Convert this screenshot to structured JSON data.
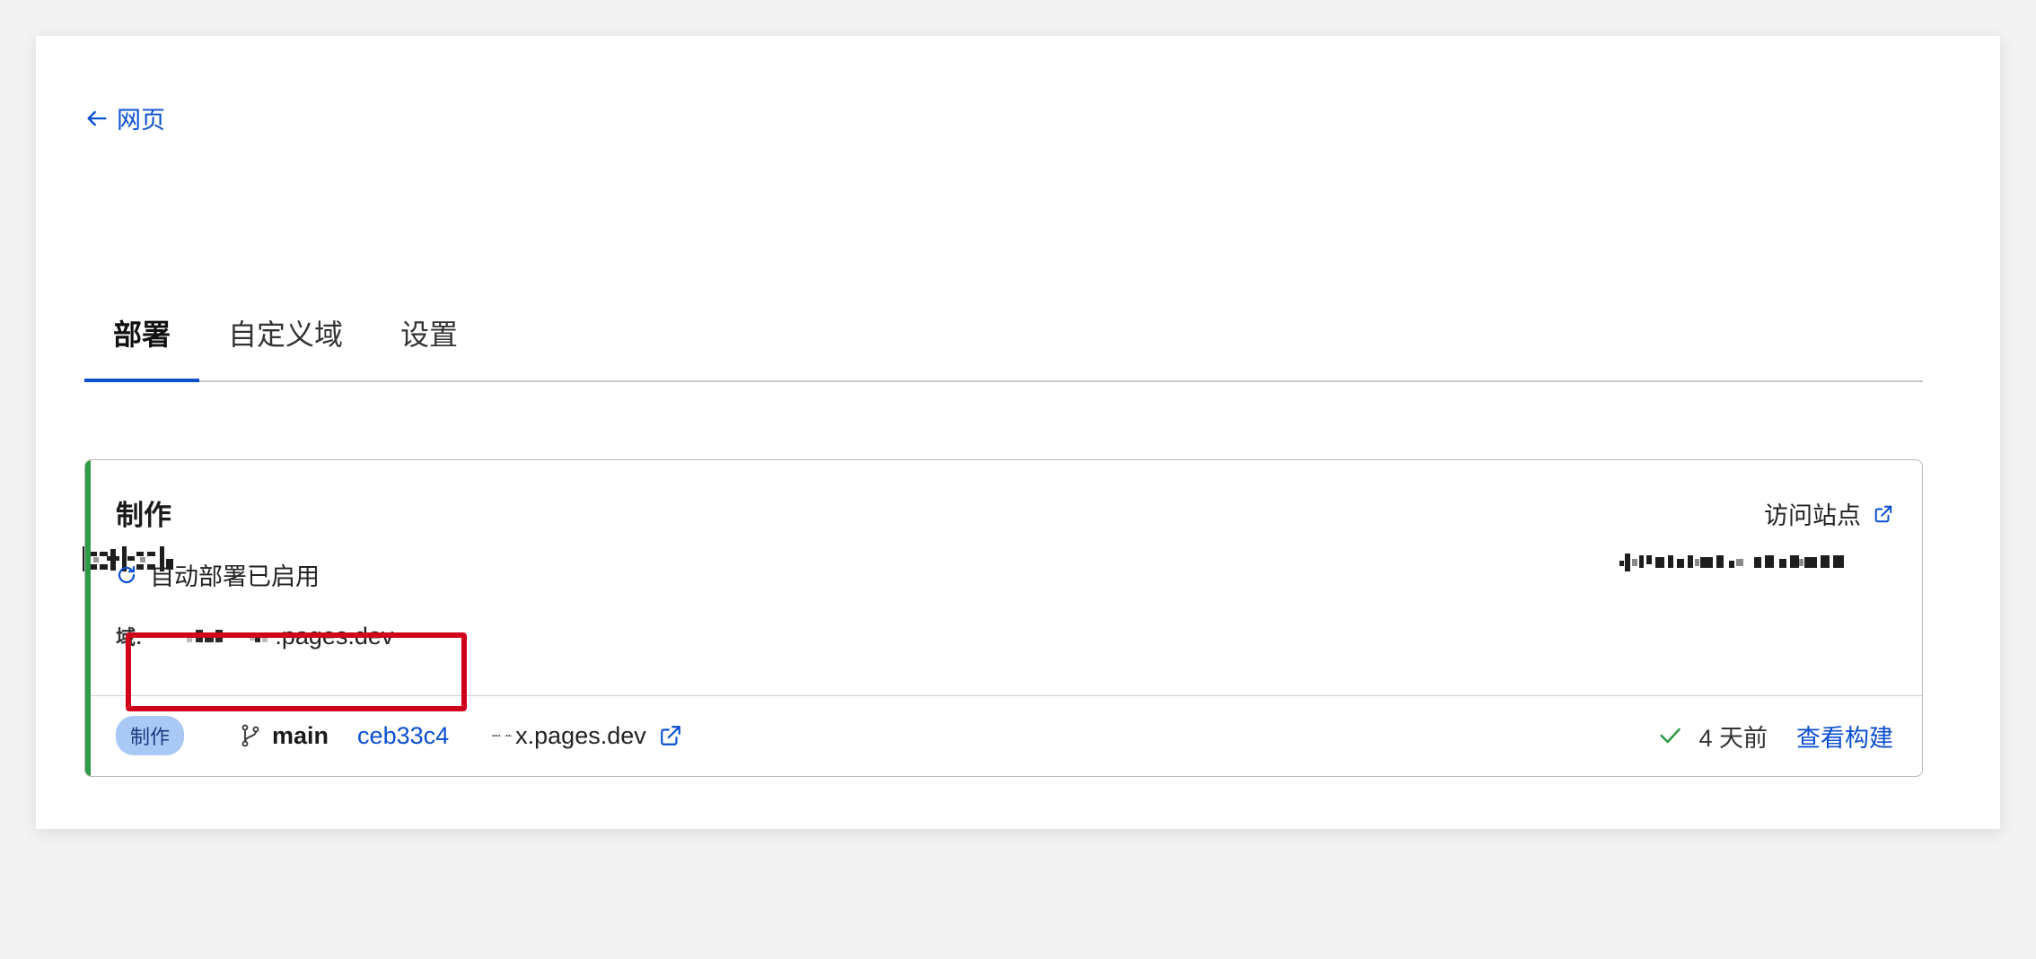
{
  "nav": {
    "back_label": "网页"
  },
  "tabs": [
    {
      "label": "部署",
      "active": true
    },
    {
      "label": "自定义域",
      "active": false
    },
    {
      "label": "设置",
      "active": false
    }
  ],
  "production": {
    "title": "制作",
    "visit_label": "访问站点",
    "auto_deploy_text": "自动部署已启用",
    "domain_label": "域:",
    "domain_suffix": ".pages.dev"
  },
  "deployment": {
    "badge": "制作",
    "branch": "main",
    "commit": "ceb33c4",
    "url_suffix": "x.pages.dev",
    "time_ago": "4 天前",
    "view_build_label": "查看构建"
  },
  "colors": {
    "accent_blue": "#0b4fd1",
    "success_green": "#2f9a48",
    "highlight_red": "#d0021b"
  }
}
